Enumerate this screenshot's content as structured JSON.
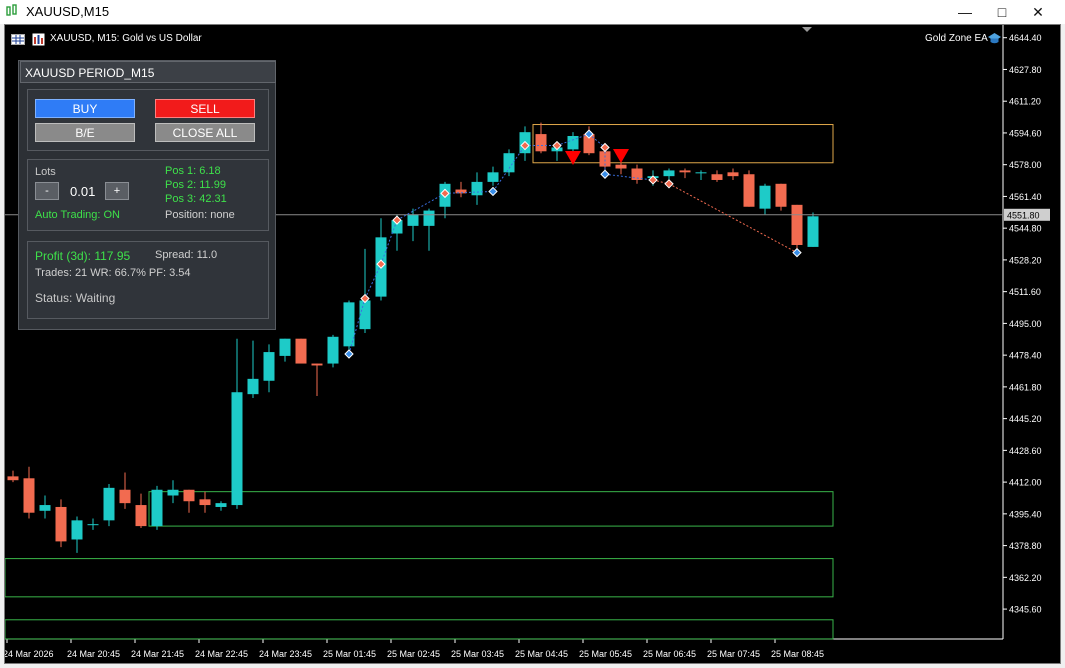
{
  "window": {
    "title": "XAUUSD,M15"
  },
  "chart_header": {
    "symbol_line": "XAUUSD, M15:  Gold vs US Dollar",
    "ea_name": "Gold Zone EA"
  },
  "ea_panel": {
    "title": "XAUUSD PERIOD_M15",
    "buttons": {
      "buy": "BUY",
      "sell": "SELL",
      "breakeven": "B/E",
      "close_all": "CLOSE ALL"
    },
    "lots": {
      "label": "Lots",
      "minus": "-",
      "value": "0.01",
      "plus": "+"
    },
    "auto_trading": "Auto Trading: ON",
    "positions": [
      "Pos 1: 6.18",
      "Pos 2: 11.99",
      "Pos 3: 42.31"
    ],
    "position_status": "Position: none",
    "stats": {
      "profit": "Profit (3d): 117.95",
      "spread": "Spread: 11.0",
      "trades_line": "Trades: 21  WR: 66.7%  PF: 3.54",
      "status": "Status: Waiting"
    }
  },
  "colors": {
    "bull": "#1ecbc8",
    "bear": "#f26b50",
    "zone_supply": "#e0a84a",
    "zone_demand": "#39b54a",
    "sell_arrow": "#ff0000"
  },
  "chart_data": {
    "type": "candlestick",
    "symbol": "XAUUSD",
    "timeframe": "M15",
    "current_price": "4551.80",
    "ylim": [
      4331.0,
      4650.0
    ],
    "y_ticks": [
      "4644.40",
      "4627.80",
      "4611.20",
      "4594.60",
      "4578.00",
      "4561.40",
      "4544.80",
      "4528.20",
      "4511.60",
      "4495.00",
      "4478.40",
      "4461.80",
      "4445.20",
      "4428.60",
      "4412.00",
      "4395.40",
      "4378.80",
      "4362.20",
      "4345.60"
    ],
    "x_ticks": [
      {
        "label": "24 Mar 2026",
        "index": 0
      },
      {
        "label": "24 Mar 20:45",
        "index": 4
      },
      {
        "label": "24 Mar 21:45",
        "index": 8
      },
      {
        "label": "24 Mar 22:45",
        "index": 12
      },
      {
        "label": "24 Mar 23:45",
        "index": 16
      },
      {
        "label": "25 Mar 01:45",
        "index": 20
      },
      {
        "label": "25 Mar 02:45",
        "index": 24
      },
      {
        "label": "25 Mar 03:45",
        "index": 28
      },
      {
        "label": "25 Mar 04:45",
        "index": 32
      },
      {
        "label": "25 Mar 05:45",
        "index": 36
      },
      {
        "label": "25 Mar 06:45",
        "index": 40
      },
      {
        "label": "25 Mar 07:45",
        "index": 44
      },
      {
        "label": "25 Mar 08:45",
        "index": 48
      }
    ],
    "candles": [
      {
        "o": 4415,
        "h": 4418,
        "l": 4412,
        "c": 4413
      },
      {
        "o": 4414,
        "h": 4420,
        "l": 4393,
        "c": 4396
      },
      {
        "o": 4397,
        "h": 4405,
        "l": 4393,
        "c": 4400
      },
      {
        "o": 4399,
        "h": 4403,
        "l": 4378,
        "c": 4381
      },
      {
        "o": 4382,
        "h": 4394,
        "l": 4375,
        "c": 4392
      },
      {
        "o": 4390,
        "h": 4393,
        "l": 4387,
        "c": 4390
      },
      {
        "o": 4392,
        "h": 4411,
        "l": 4389,
        "c": 4409
      },
      {
        "o": 4408,
        "h": 4417,
        "l": 4398,
        "c": 4401
      },
      {
        "o": 4400,
        "h": 4406,
        "l": 4388,
        "c": 4389
      },
      {
        "o": 4389,
        "h": 4410,
        "l": 4387,
        "c": 4408
      },
      {
        "o": 4405,
        "h": 4413,
        "l": 4401,
        "c": 4408
      },
      {
        "o": 4408,
        "h": 4408,
        "l": 4396,
        "c": 4402
      },
      {
        "o": 4403,
        "h": 4407,
        "l": 4396,
        "c": 4400
      },
      {
        "o": 4399,
        "h": 4402,
        "l": 4397,
        "c": 4401
      },
      {
        "o": 4400,
        "h": 4487,
        "l": 4398,
        "c": 4459
      },
      {
        "o": 4458,
        "h": 4486,
        "l": 4456,
        "c": 4466
      },
      {
        "o": 4465,
        "h": 4484,
        "l": 4459,
        "c": 4480
      },
      {
        "o": 4478,
        "h": 4487,
        "l": 4475,
        "c": 4487
      },
      {
        "o": 4487,
        "h": 4487,
        "l": 4474,
        "c": 4474
      },
      {
        "o": 4474,
        "h": 4474,
        "l": 4457,
        "c": 4473
      },
      {
        "o": 4474,
        "h": 4489,
        "l": 4472,
        "c": 4488
      },
      {
        "o": 4483,
        "h": 4507,
        "l": 4481,
        "c": 4506
      },
      {
        "o": 4492,
        "h": 4534,
        "l": 4490,
        "c": 4507
      },
      {
        "o": 4509,
        "h": 4550,
        "l": 4507,
        "c": 4540
      },
      {
        "o": 4542,
        "h": 4552,
        "l": 4533,
        "c": 4549
      },
      {
        "o": 4546,
        "h": 4555,
        "l": 4538,
        "c": 4552
      },
      {
        "o": 4546,
        "h": 4555,
        "l": 4533,
        "c": 4554
      },
      {
        "o": 4556,
        "h": 4569,
        "l": 4550,
        "c": 4568
      },
      {
        "o": 4565,
        "h": 4569,
        "l": 4561,
        "c": 4563
      },
      {
        "o": 4562,
        "h": 4574,
        "l": 4557,
        "c": 4569
      },
      {
        "o": 4569,
        "h": 4577,
        "l": 4567,
        "c": 4574
      },
      {
        "o": 4574,
        "h": 4586,
        "l": 4572,
        "c": 4584
      },
      {
        "o": 4584,
        "h": 4598,
        "l": 4580,
        "c": 4595
      },
      {
        "o": 4594,
        "h": 4600,
        "l": 4584,
        "c": 4585
      },
      {
        "o": 4585,
        "h": 4590,
        "l": 4580,
        "c": 4587
      },
      {
        "o": 4586,
        "h": 4595,
        "l": 4582,
        "c": 4593
      },
      {
        "o": 4594,
        "h": 4598,
        "l": 4583,
        "c": 4584
      },
      {
        "o": 4585,
        "h": 4587,
        "l": 4575,
        "c": 4577
      },
      {
        "o": 4578,
        "h": 4582,
        "l": 4573,
        "c": 4576
      },
      {
        "o": 4576,
        "h": 4578,
        "l": 4568,
        "c": 4570
      },
      {
        "o": 4571,
        "h": 4575,
        "l": 4567,
        "c": 4572
      },
      {
        "o": 4572,
        "h": 4576,
        "l": 4570,
        "c": 4575
      },
      {
        "o": 4575,
        "h": 4576,
        "l": 4571,
        "c": 4574
      },
      {
        "o": 4574,
        "h": 4575,
        "l": 4570,
        "c": 4574
      },
      {
        "o": 4573,
        "h": 4575,
        "l": 4569,
        "c": 4570
      },
      {
        "o": 4574,
        "h": 4576,
        "l": 4570,
        "c": 4572
      },
      {
        "o": 4573,
        "h": 4575,
        "l": 4556,
        "c": 4556
      },
      {
        "o": 4555,
        "h": 4568,
        "l": 4552,
        "c": 4567
      },
      {
        "o": 4568,
        "h": 4568,
        "l": 4554,
        "c": 4556
      },
      {
        "o": 4557,
        "h": 4557,
        "l": 4533,
        "c": 4536
      },
      {
        "o": 4535,
        "h": 4553,
        "l": 4535,
        "c": 4551
      }
    ],
    "zones": [
      {
        "kind": "supply",
        "i_start": 33,
        "i_end": 51,
        "top": 4599,
        "bottom": 4579
      },
      {
        "kind": "demand",
        "i_start": 9,
        "i_end": 51,
        "top": 4407,
        "bottom": 4389
      },
      {
        "kind": "demand",
        "i_start": 0,
        "i_end": 51,
        "top": 4372,
        "bottom": 4352
      },
      {
        "kind": "demand",
        "i_start": 0,
        "i_end": 51,
        "top": 4340,
        "bottom": 4330
      }
    ],
    "trade_markers": [
      {
        "i": 21,
        "price": 4479,
        "type": "buy"
      },
      {
        "i": 22,
        "price": 4508,
        "type": "sell"
      },
      {
        "i": 23,
        "price": 4526,
        "type": "sell"
      },
      {
        "i": 24,
        "price": 4549,
        "type": "sell"
      },
      {
        "i": 27,
        "price": 4563,
        "type": "sell"
      },
      {
        "i": 30,
        "price": 4564,
        "type": "buy"
      },
      {
        "i": 32,
        "price": 4588,
        "type": "sell"
      },
      {
        "i": 34,
        "price": 4588,
        "type": "sell"
      },
      {
        "i": 36,
        "price": 4594,
        "type": "buy"
      },
      {
        "i": 37,
        "price": 4587,
        "type": "sell"
      },
      {
        "i": 37,
        "price": 4573,
        "type": "buy"
      },
      {
        "i": 40,
        "price": 4570,
        "type": "sell"
      },
      {
        "i": 41,
        "price": 4568,
        "type": "sell"
      },
      {
        "i": 49,
        "price": 4532,
        "type": "buy"
      }
    ],
    "sell_arrows": [
      {
        "i": 35,
        "price": 4581
      },
      {
        "i": 38,
        "price": 4582
      }
    ]
  }
}
